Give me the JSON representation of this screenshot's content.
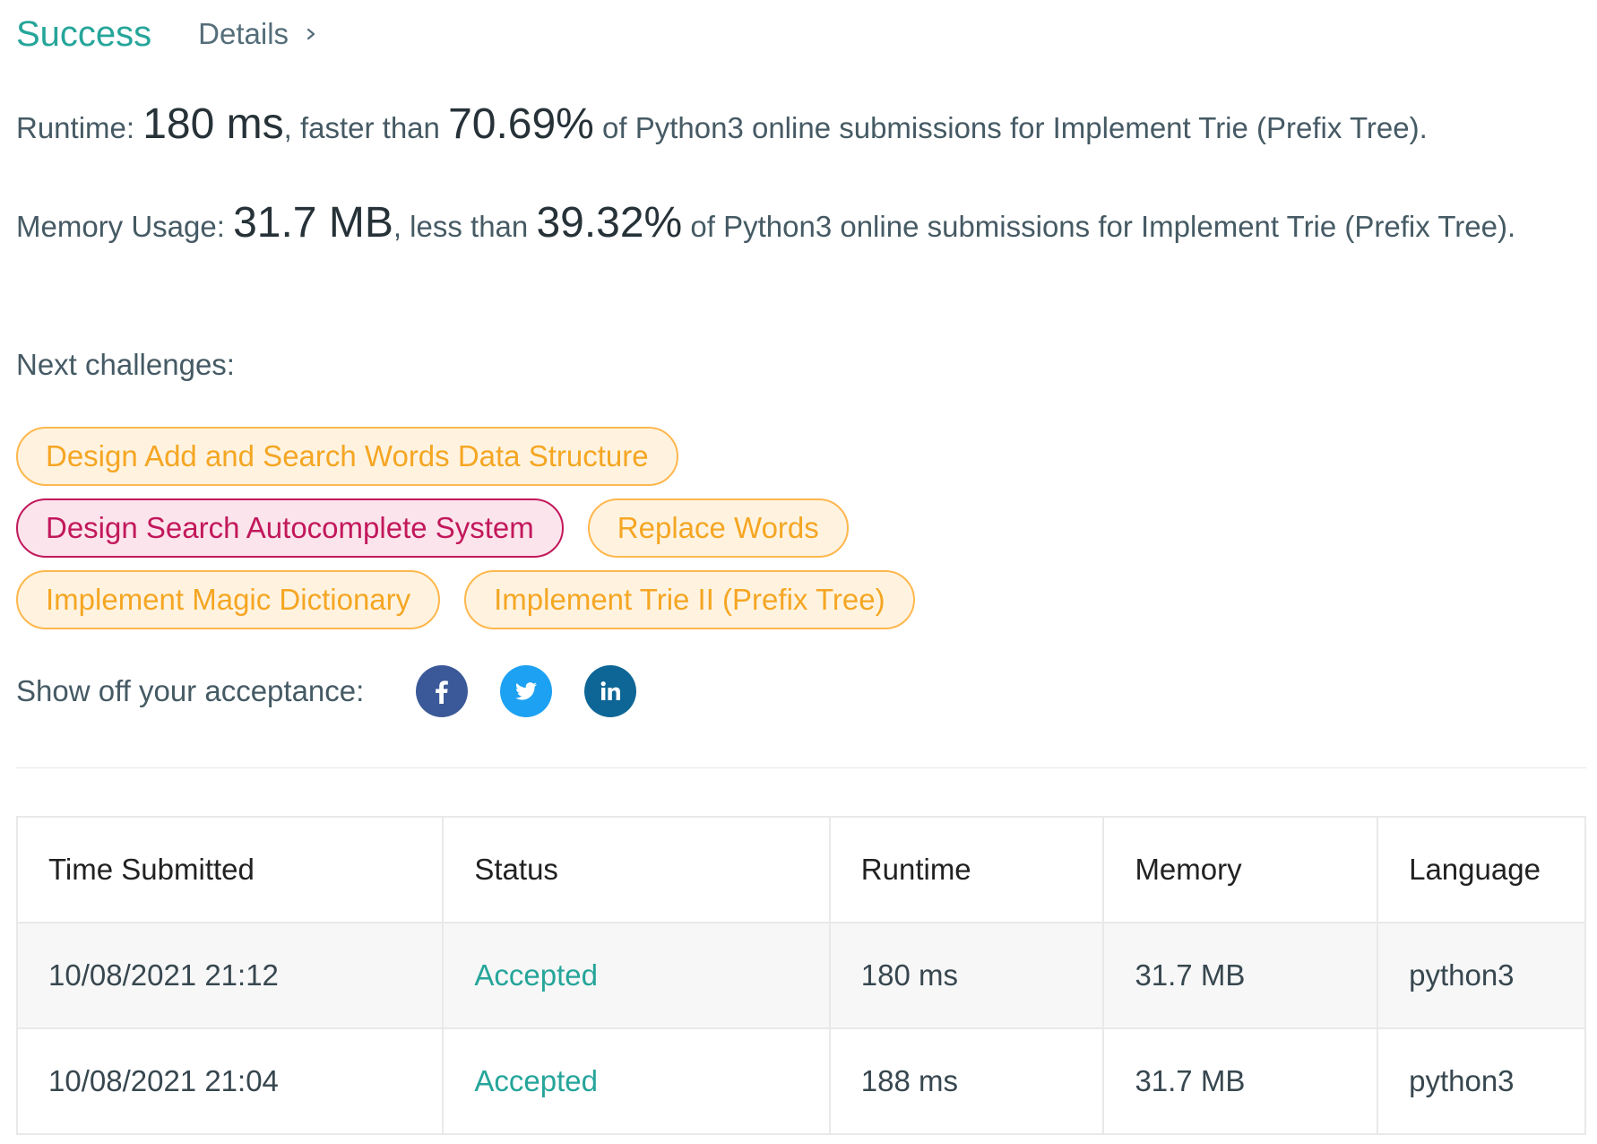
{
  "header": {
    "status": "Success",
    "details_label": "Details"
  },
  "runtime": {
    "prefix": "Runtime: ",
    "value": "180 ms",
    "middle": ", faster than ",
    "percent": "70.69%",
    "suffix": " of Python3 online submissions for Implement Trie (Prefix Tree)."
  },
  "memory": {
    "prefix": "Memory Usage: ",
    "value": "31.7 MB",
    "middle": ", less than ",
    "percent": "39.32%",
    "suffix": " of Python3 online submissions for Implement Trie (Prefix Tree)."
  },
  "next_challenges": {
    "label": "Next challenges:",
    "items": [
      {
        "label": "Design Add and Search Words Data Structure",
        "difficulty": "medium"
      },
      {
        "label": "Design Search Autocomplete System",
        "difficulty": "hard"
      },
      {
        "label": "Replace Words",
        "difficulty": "medium"
      },
      {
        "label": "Implement Magic Dictionary",
        "difficulty": "medium"
      },
      {
        "label": "Implement Trie II (Prefix Tree)",
        "difficulty": "medium"
      }
    ]
  },
  "share": {
    "label": "Show off your acceptance:",
    "icons": [
      "facebook-icon",
      "twitter-icon",
      "linkedin-icon"
    ]
  },
  "submissions": {
    "columns": [
      "Time Submitted",
      "Status",
      "Runtime",
      "Memory",
      "Language"
    ],
    "rows": [
      {
        "time": "10/08/2021 21:12",
        "status": "Accepted",
        "runtime": "180 ms",
        "memory": "31.7 MB",
        "language": "python3"
      },
      {
        "time": "10/08/2021 21:04",
        "status": "Accepted",
        "runtime": "188 ms",
        "memory": "31.7 MB",
        "language": "python3"
      }
    ]
  },
  "colors": {
    "success": "#26a59a",
    "medium": "#f5a623",
    "hard": "#c2185b",
    "facebook": "#3b5998",
    "twitter": "#1da1f2",
    "linkedin": "#0e6696"
  }
}
